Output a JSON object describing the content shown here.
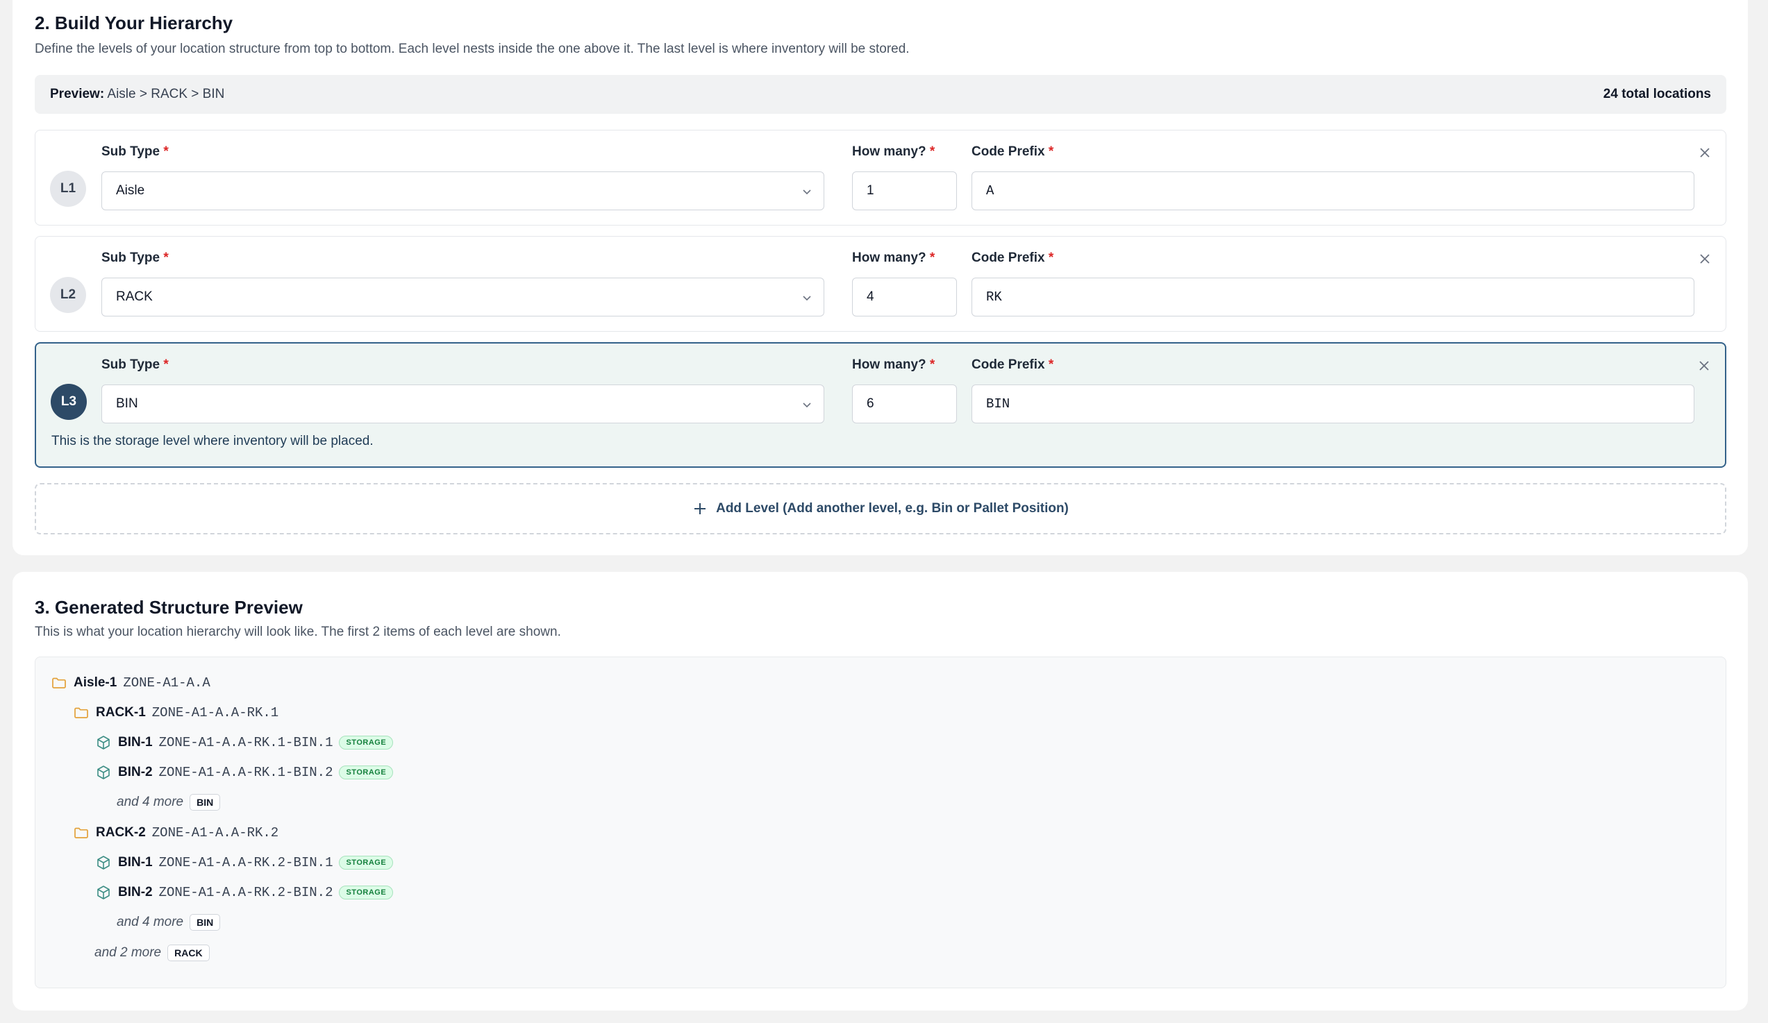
{
  "hierarchy": {
    "title": "2. Build Your Hierarchy",
    "description": "Define the levels of your location structure from top to bottom. Each level nests inside the one above it. The last level is where inventory will be stored.",
    "preview_label": "Preview:",
    "preview_path": "Aisle > RACK > BIN",
    "total_locations": "24 total locations",
    "field_labels": {
      "sub_type": "Sub Type",
      "how_many": "How many?",
      "code_prefix": "Code Prefix",
      "required_mark": "*"
    },
    "levels": [
      {
        "badge": "L1",
        "sub_type": "Aisle",
        "how_many": "1",
        "code_prefix": "A"
      },
      {
        "badge": "L2",
        "sub_type": "RACK",
        "how_many": "4",
        "code_prefix": "RK"
      },
      {
        "badge": "L3",
        "sub_type": "BIN",
        "how_many": "6",
        "code_prefix": "BIN",
        "storage_note": "This is the storage level where inventory will be placed."
      }
    ],
    "add_level_label": "Add Level (Add another level, e.g. Bin or Pallet Position)"
  },
  "structure": {
    "title": "3. Generated Structure Preview",
    "description": "This is what your location hierarchy will look like. The first 2 items of each level are shown.",
    "storage_badge": "STORAGE",
    "tree": {
      "aisle": {
        "name": "Aisle-1",
        "code": "ZONE-A1-A.A"
      },
      "racks": [
        {
          "name": "RACK-1",
          "code": "ZONE-A1-A.A-RK.1",
          "bins": [
            {
              "name": "BIN-1",
              "code": "ZONE-A1-A.A-RK.1-BIN.1"
            },
            {
              "name": "BIN-2",
              "code": "ZONE-A1-A.A-RK.1-BIN.2"
            }
          ],
          "more_text": "and 4 more",
          "more_type": "BIN"
        },
        {
          "name": "RACK-2",
          "code": "ZONE-A1-A.A-RK.2",
          "bins": [
            {
              "name": "BIN-1",
              "code": "ZONE-A1-A.A-RK.2-BIN.1"
            },
            {
              "name": "BIN-2",
              "code": "ZONE-A1-A.A-RK.2-BIN.2"
            }
          ],
          "more_text": "and 4 more",
          "more_type": "BIN"
        }
      ],
      "racks_more_text": "and 2 more",
      "racks_more_type": "RACK"
    }
  },
  "colors": {
    "accent": "#2d4a67",
    "required": "#dc2626",
    "folder_icon": "#e3a23a",
    "box_icon": "#3f8f86",
    "storage_badge_bg": "#dcfce7",
    "active_level_bg": "#eef5f3"
  },
  "icons": [
    "chevron-down-icon",
    "close-icon",
    "plus-icon",
    "folder-icon",
    "box-icon"
  ]
}
